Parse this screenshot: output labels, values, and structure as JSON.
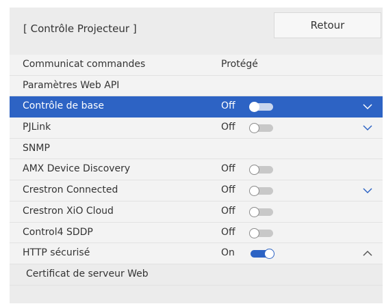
{
  "header": {
    "title": "[ Contrôle Projecteur ]",
    "back_label": "Retour"
  },
  "colors": {
    "accent": "#2d63c4",
    "background": "#ececec",
    "row": "#f3f3f3"
  },
  "rows": [
    {
      "label": "Communicat commandes",
      "value": "Protégé",
      "toggle": null,
      "chevron": null,
      "selected": false
    },
    {
      "label": "Paramètres Web API",
      "value": "",
      "toggle": null,
      "chevron": null,
      "selected": false
    },
    {
      "label": "Contrôle de base",
      "value": "Off",
      "toggle": "off",
      "chevron": "chevron-down-icon",
      "selected": true
    },
    {
      "label": "PJLink",
      "value": "Off",
      "toggle": "off",
      "chevron": "chevron-down-icon",
      "selected": false
    },
    {
      "label": "SNMP",
      "value": "",
      "toggle": null,
      "chevron": null,
      "selected": false
    },
    {
      "label": "AMX Device Discovery",
      "value": "Off",
      "toggle": "off",
      "chevron": null,
      "selected": false
    },
    {
      "label": "Crestron Connected",
      "value": "Off",
      "toggle": "off",
      "chevron": "chevron-down-icon",
      "selected": false
    },
    {
      "label": "Crestron XiO Cloud",
      "value": "Off",
      "toggle": "off",
      "chevron": null,
      "selected": false
    },
    {
      "label": "Control4 SDDP",
      "value": "Off",
      "toggle": "off",
      "chevron": null,
      "selected": false
    },
    {
      "label": "HTTP sécurisé",
      "value": "On",
      "toggle": "on",
      "chevron": "chevron-up-icon",
      "selected": false
    },
    {
      "label": "Certificat de serveur Web",
      "value": "",
      "toggle": null,
      "chevron": null,
      "selected": false,
      "sub": true
    }
  ]
}
